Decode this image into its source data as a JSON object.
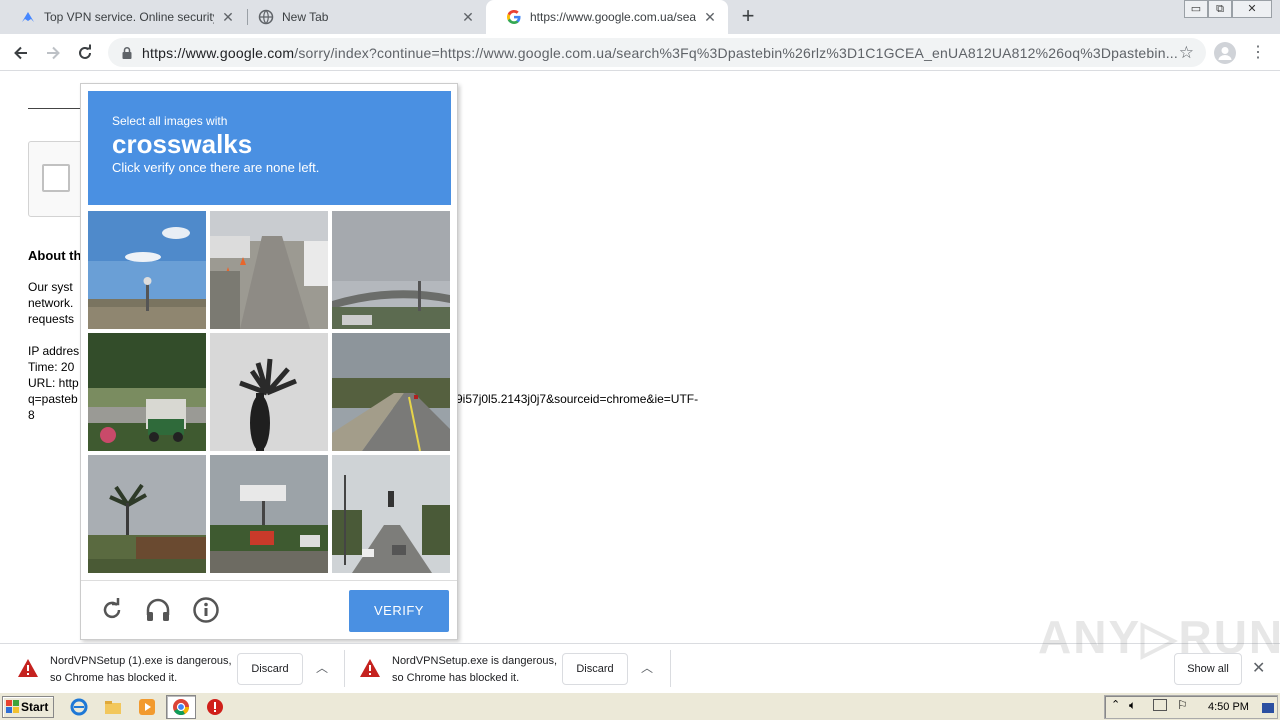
{
  "browser": {
    "tabs": [
      {
        "title": "Top VPN service. Online security sta",
        "icon": "nordvpn-icon",
        "active": false
      },
      {
        "title": "New Tab",
        "icon": "globe-icon",
        "active": false
      },
      {
        "title": "https://www.google.com.ua/search",
        "icon": "google-icon",
        "active": true
      }
    ],
    "new_tab_symbol": "+",
    "window_controls": [
      "▭",
      "⧉",
      "✕"
    ],
    "url_domain": "https://www.google.com",
    "url_path": "/sorry/index?continue=https://www.google.com.ua/search%3Fq%3Dpastebin%26rlz%3D1C1GCEA_enUA812UA812%26oq%3Dpastebin..."
  },
  "page": {
    "about_heading": "About th",
    "lines_a": [
      "Our syst",
      "network.",
      "requests"
    ],
    "lines_b": [
      "IP addres",
      "Time: 20",
      "URL: http",
      "q=pasteb",
      "8"
    ],
    "url_tail": "9i57j0l5.2143j0j7&sourceid=chrome&ie=UTF-"
  },
  "captcha": {
    "prompt_line1": "Select all images with",
    "prompt_target": "crosswalks",
    "prompt_line3": "Click verify once there are none left.",
    "verify_label": "VERIFY",
    "footer_icons": [
      "reload-icon",
      "audio-headphones-icon",
      "info-icon"
    ]
  },
  "downloads": {
    "items": [
      {
        "line1": "NordVPNSetup (1).exe is dangerous,",
        "line2": "so Chrome has blocked it.",
        "discard": "Discard"
      },
      {
        "line1": "NordVPNSetup.exe is dangerous,",
        "line2": "so Chrome has blocked it.",
        "discard": "Discard"
      }
    ],
    "show_all": "Show all",
    "watermark": "ANY▷RUN"
  },
  "taskbar": {
    "start_label": "Start",
    "clock": "4:50 PM",
    "apps": [
      "ie-icon",
      "folder-icon",
      "media-player-icon",
      "chrome-icon",
      "stop-icon"
    ]
  },
  "colors": {
    "captcha_blue": "#4a90e2",
    "warning_red": "#c5221f"
  }
}
